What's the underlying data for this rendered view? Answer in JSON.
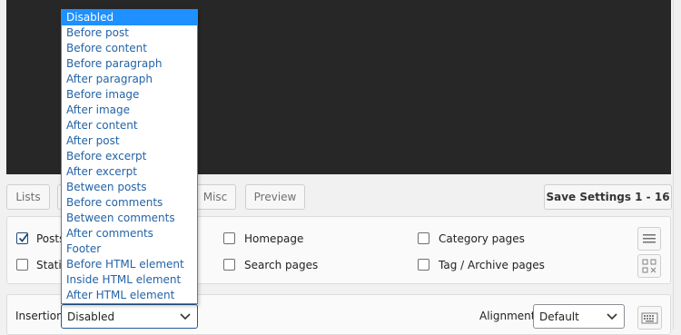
{
  "tabs": [
    "Lists",
    "",
    "",
    "Misc",
    "Preview"
  ],
  "save_button": "Save Settings 1 - 16",
  "pages": {
    "posts": "Posts",
    "static": "Static",
    "homepage": "Homepage",
    "search": "Search pages",
    "category": "Category pages",
    "tag_archive": "Tag / Archive pages"
  },
  "insertion": {
    "label": "Insertion",
    "value": "Disabled",
    "options": [
      "Disabled",
      "Before post",
      "Before content",
      "Before paragraph",
      "After paragraph",
      "Before image",
      "After image",
      "After content",
      "After post",
      "Before excerpt",
      "After excerpt",
      "Between posts",
      "Before comments",
      "Between comments",
      "After comments",
      "Footer",
      "Before HTML element",
      "Inside HTML element",
      "After HTML element"
    ]
  },
  "alignment": {
    "label": "Alignment",
    "value": "Default"
  },
  "colors": {
    "selected": "#1e90ff",
    "option_text": "#2463a6",
    "editor_bg": "#272727"
  }
}
